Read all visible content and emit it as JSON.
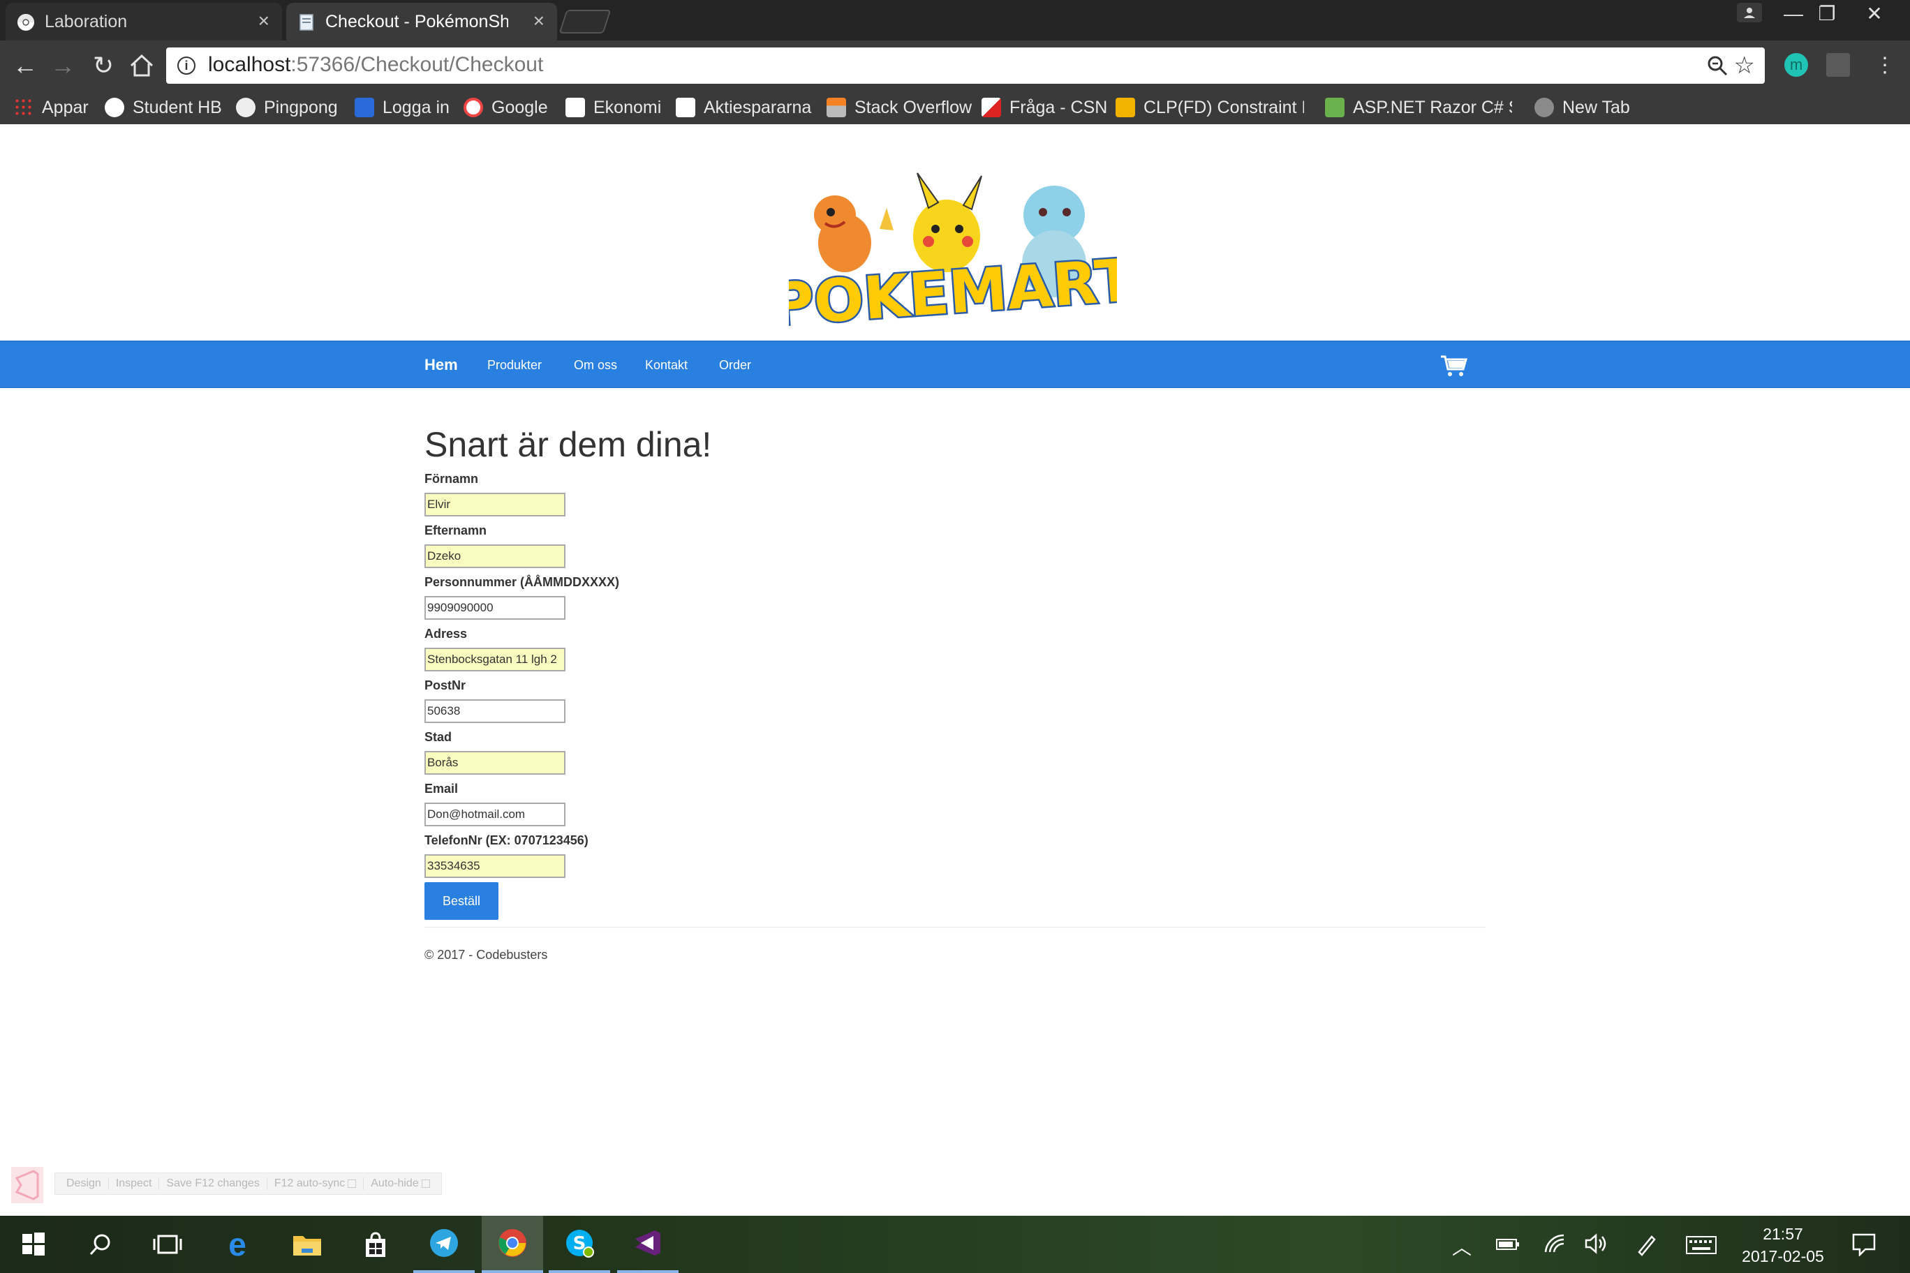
{
  "browser": {
    "tabs": [
      {
        "title": "Laboration",
        "close": "×"
      },
      {
        "title": "Checkout - PokémonSho",
        "close": "×"
      }
    ],
    "url_host": "localhost",
    "url_path": ":57366/Checkout/Checkout",
    "window_buttons": {
      "minimize": "—",
      "restore": "❐",
      "close": "✕"
    },
    "bookmarks": [
      {
        "label": "Appar"
      },
      {
        "label": "Student HB"
      },
      {
        "label": "Pingpong"
      },
      {
        "label": "Logga in"
      },
      {
        "label": "Google"
      },
      {
        "label": "Ekonomi"
      },
      {
        "label": "Aktiespararna"
      },
      {
        "label": "Stack Overflow"
      },
      {
        "label": "Fråga - CSN"
      },
      {
        "label": "CLP(FD) Constraint Lo"
      },
      {
        "label": "ASP.NET Razor C# Syn"
      },
      {
        "label": "New Tab"
      }
    ]
  },
  "nav": {
    "brand": "Hem",
    "links": [
      "Produkter",
      "Om oss",
      "Kontakt",
      "Order"
    ]
  },
  "logo_text": "POKEMART",
  "checkout": {
    "heading": "Snart är dem dina!",
    "fields": [
      {
        "label": "Förnamn",
        "value": "Elvir"
      },
      {
        "label": "Efternamn",
        "value": "Dzeko"
      },
      {
        "label": "Personnummer (ÅÅMMDDXXXX)",
        "value": "9909090000"
      },
      {
        "label": "Adress",
        "value": "Stenbocksgatan 11 lgh 2"
      },
      {
        "label": "PostNr",
        "value": "50638"
      },
      {
        "label": "Stad",
        "value": "Borås"
      },
      {
        "label": "Email",
        "value": "Don@hotmail.com"
      },
      {
        "label": "TelefonNr (EX: 0707123456)",
        "value": "33534635"
      }
    ],
    "submit_label": "Beställ"
  },
  "footer": "© 2017 - Codebusters",
  "browser_link": [
    "Design",
    "Inspect",
    "Save F12 changes",
    "F12 auto-sync",
    "Auto-hide"
  ],
  "taskbar": {
    "time": "21:57",
    "date": "2017-02-05"
  },
  "colors": {
    "navbar": "#2980e0",
    "autofill": "#fafcc0",
    "button": "#2980e0"
  }
}
